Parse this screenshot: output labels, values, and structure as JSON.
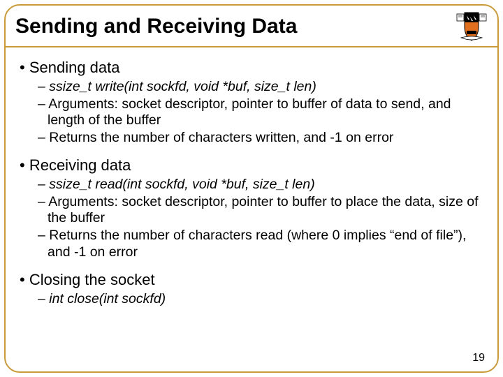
{
  "title": "Sending and Receiving Data",
  "sections": [
    {
      "heading": "Sending data",
      "items": [
        {
          "text": "ssize_t write(int sockfd, void *buf, size_t len)",
          "italic": true
        },
        {
          "text": "Arguments: socket descriptor, pointer to buffer of data to send, and length of the buffer"
        },
        {
          "text": "Returns the number of characters written, and -1 on error"
        }
      ]
    },
    {
      "heading": "Receiving data",
      "items": [
        {
          "text": "ssize_t read(int sockfd, void *buf, size_t len)",
          "italic": true
        },
        {
          "text": "Arguments: socket descriptor, pointer to buffer to place the data, size of the buffer"
        },
        {
          "text": "Returns the number of characters read (where 0 implies “end of file”), and -1 on error"
        }
      ]
    },
    {
      "heading": "Closing the socket",
      "items": [
        {
          "text": "int close(int sockfd)",
          "italic": true
        }
      ]
    }
  ],
  "page_number": "19"
}
